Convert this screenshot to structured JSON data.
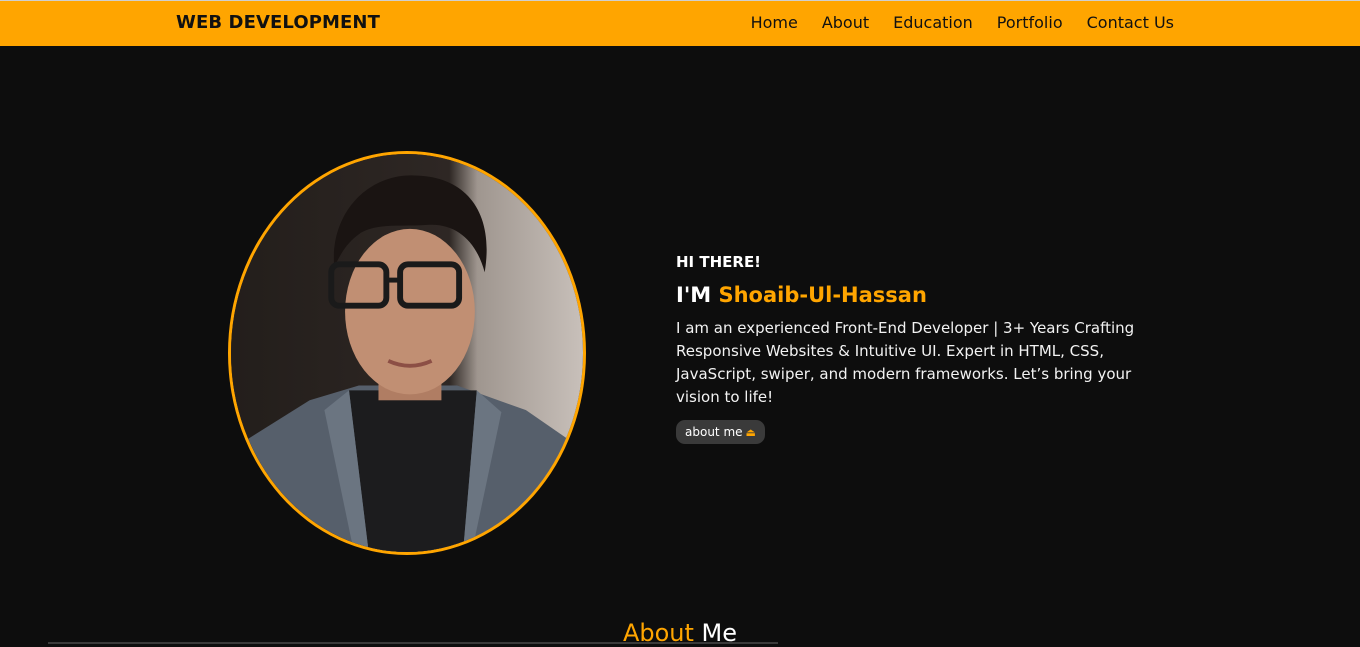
{
  "nav": {
    "brand": "WEB DEVELOPMENT",
    "links": [
      "Home",
      "About",
      "Education",
      "Portfolio",
      "Contact Us"
    ]
  },
  "hero": {
    "greeting": "HI THERE!",
    "name_prefix": "I'M ",
    "name": "Shoaib-Ul-Hassan",
    "bio": "I am an experienced Front-End Developer | 3+ Years Crafting Responsive Websites & Intuitive UI. Expert in HTML, CSS, JavaScript, swiper, and modern frameworks. Let’s bring your vision to life!",
    "button_label": "about me",
    "button_icon": "eject-icon"
  },
  "about_section": {
    "title_accent": "About",
    "title_rest": " Me"
  },
  "colors": {
    "accent": "#ffa500",
    "background": "#0d0d0d",
    "button_bg": "#3a3a3a"
  }
}
